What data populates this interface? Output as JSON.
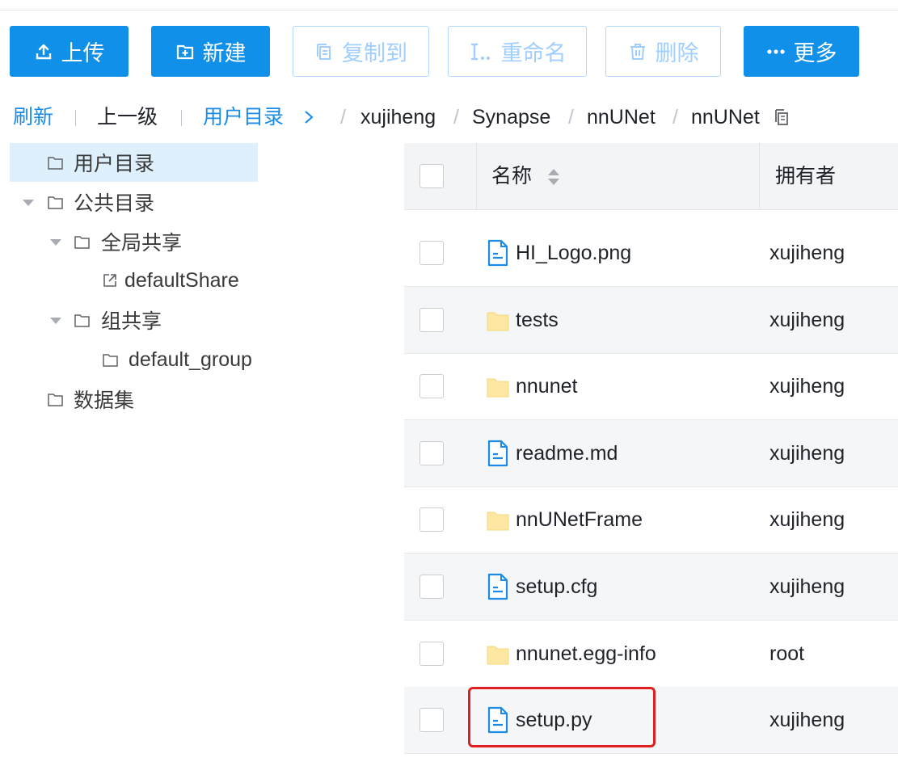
{
  "toolbar": {
    "upload": "上传",
    "new": "新建",
    "copy_to": "复制到",
    "rename": "重命名",
    "delete": "删除",
    "more": "更多"
  },
  "nav": {
    "refresh": "刷新",
    "up_level": "上一级",
    "user_dir": "用户目录",
    "path": [
      "xujiheng",
      "Synapse",
      "nnUNet",
      "nnUNet"
    ]
  },
  "tree": {
    "user_dir": "用户目录",
    "public_dir": "公共目录",
    "global_share": "全局共享",
    "default_share": "defaultShare",
    "group_share": "组共享",
    "default_group": "default_group",
    "datasets": "数据集"
  },
  "table": {
    "col_name": "名称",
    "col_owner": "拥有者",
    "rows": [
      {
        "name": "HI_Logo.png",
        "owner": "xujiheng",
        "type": "file"
      },
      {
        "name": "tests",
        "owner": "xujiheng",
        "type": "folder"
      },
      {
        "name": "nnunet",
        "owner": "xujiheng",
        "type": "folder"
      },
      {
        "name": "readme.md",
        "owner": "xujiheng",
        "type": "file"
      },
      {
        "name": "nnUNetFrame",
        "owner": "xujiheng",
        "type": "folder"
      },
      {
        "name": "setup.cfg",
        "owner": "xujiheng",
        "type": "file"
      },
      {
        "name": "nnunet.egg-info",
        "owner": "root",
        "type": "folder"
      },
      {
        "name": "setup.py",
        "owner": "xujiheng",
        "type": "file"
      }
    ]
  },
  "colors": {
    "primary": "#1090e8",
    "link": "#1a8be6",
    "disabled_text": "#a0cfff",
    "folder": "#fce7a3",
    "file_icon": "#1a8be6",
    "highlight": "#e02020"
  }
}
